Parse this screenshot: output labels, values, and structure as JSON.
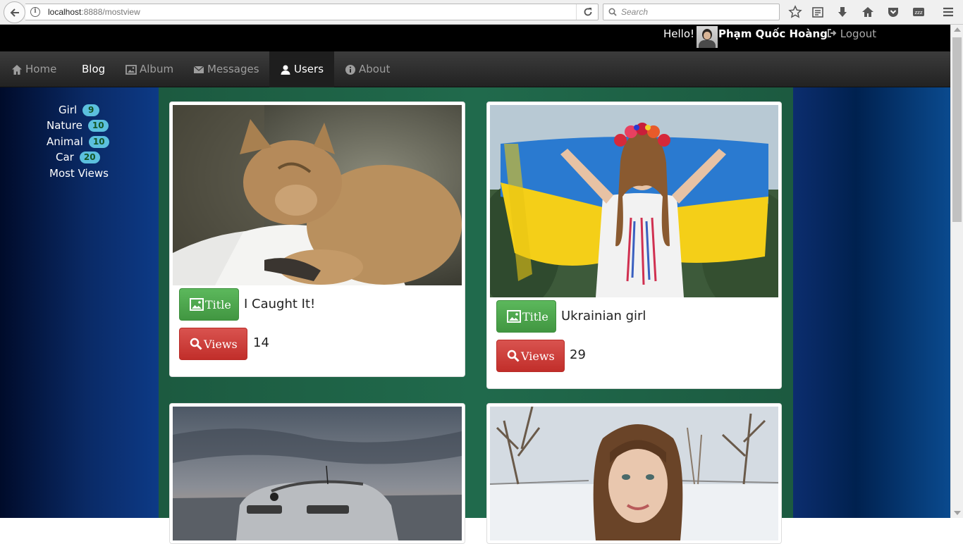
{
  "browser": {
    "url_host": "localhost",
    "url_rest": ":8888/mostview",
    "search_placeholder": "Search"
  },
  "topbar": {
    "greeting": "Hello!",
    "username": "Phạm Quốc Hoàng",
    "logout_label": "Logout"
  },
  "nav": {
    "home": "Home",
    "blog": "Blog",
    "album": "Album",
    "messages": "Messages",
    "users": "Users",
    "about": "About"
  },
  "sidebar": {
    "categories": [
      {
        "label": "Girl",
        "count": "9"
      },
      {
        "label": "Nature",
        "count": "10"
      },
      {
        "label": "Animal",
        "count": "10"
      },
      {
        "label": "Car",
        "count": "20"
      }
    ],
    "most_views": "Most Views"
  },
  "posts": [
    {
      "title_label": "Title",
      "title": "I Caught It!",
      "views_label": "Views",
      "views": "14"
    },
    {
      "title_label": "Title",
      "title": "Ukrainian girl",
      "views_label": "Views",
      "views": "29"
    }
  ],
  "colors": {
    "success": "#5cb85c",
    "danger": "#d9534f",
    "badge": "#5bc0de",
    "main_bg": "#206a4c",
    "navbar_bg": "#222222"
  }
}
